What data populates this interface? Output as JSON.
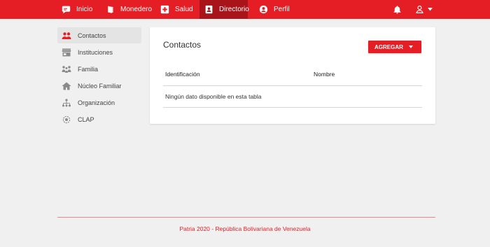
{
  "nav": {
    "items": [
      {
        "label": "Inicio",
        "icon": "chat-bubble-icon"
      },
      {
        "label": "Monedero",
        "icon": "wallet-icon"
      },
      {
        "label": "Salud",
        "icon": "health-cross-icon"
      },
      {
        "label": "Directorio",
        "icon": "contacts-book-icon",
        "active": true
      },
      {
        "label": "Perfil",
        "icon": "user-circle-icon"
      }
    ],
    "notifications_icon": "bell-icon",
    "user_menu_icon": "user-icon"
  },
  "sidebar": {
    "items": [
      {
        "label": "Contactos",
        "icon": "people-icon",
        "active": true
      },
      {
        "label": "Instituciones",
        "icon": "store-icon"
      },
      {
        "label": "Familia",
        "icon": "family-icon"
      },
      {
        "label": "Núcleo Familiar",
        "icon": "home-icon"
      },
      {
        "label": "Organización",
        "icon": "org-chart-icon"
      },
      {
        "label": "CLAP",
        "icon": "clap-icon"
      }
    ]
  },
  "main": {
    "title": "Contactos",
    "add_button": "AGREGAR",
    "table": {
      "columns": [
        "Identificación",
        "Nombre"
      ],
      "empty_message": "Ningún dato disponible en esta tabla"
    }
  },
  "footer": {
    "text": "Patria 2020 - República Bolivariana de Venezuela"
  },
  "colors": {
    "brand_red": "#e51e25",
    "brand_red_dark": "#a8141a",
    "background": "#f0f0f0"
  }
}
